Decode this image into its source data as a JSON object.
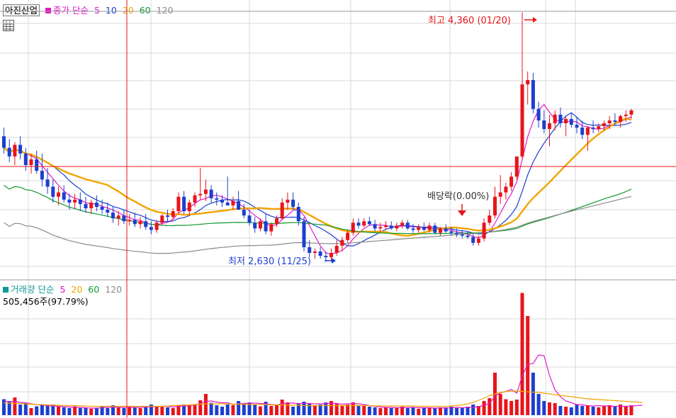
{
  "price_legend": {
    "stock_name": "아진산업",
    "label": "종가 단순",
    "periods": [
      "5",
      "10",
      "20",
      "60",
      "120"
    ]
  },
  "volume_legend": {
    "label": "거래량 단순",
    "periods": [
      "5",
      "20",
      "60",
      "120"
    ],
    "current_volume": "505,456주(97.79%)"
  },
  "annotations": {
    "high": "최고 4,360 (01/20)",
    "low": "최저 2,630 (11/25)",
    "dividend": "배당락(0.00%)"
  },
  "colors": {
    "up": "#e8141b",
    "down": "#1c3fd0",
    "ma5": "#e01bc6",
    "ma10": "#1c3fd0",
    "ma20": "#f2a400",
    "ma60": "#0f9a2e",
    "ma120": "#8a8a8a",
    "crosshair": "#e8141b",
    "grid": "#d8d8d8"
  },
  "chart_data": {
    "type": "candlestick",
    "ma_periods": [
      5,
      10,
      20,
      60,
      120
    ],
    "high": {
      "value": 4360,
      "date": "01/20"
    },
    "low": {
      "value": 2630,
      "date": "11/25"
    },
    "candles": [
      [
        3500,
        3560,
        3380,
        3420,
        45
      ],
      [
        3420,
        3480,
        3320,
        3360,
        40
      ],
      [
        3360,
        3460,
        3300,
        3440,
        50
      ],
      [
        3440,
        3500,
        3340,
        3380,
        30
      ],
      [
        3380,
        3420,
        3260,
        3300,
        35
      ],
      [
        3300,
        3380,
        3240,
        3340,
        20
      ],
      [
        3340,
        3400,
        3240,
        3260,
        25
      ],
      [
        3260,
        3380,
        3150,
        3200,
        30
      ],
      [
        3200,
        3280,
        3100,
        3150,
        28
      ],
      [
        3150,
        3200,
        3040,
        3080,
        30
      ],
      [
        3080,
        3150,
        3020,
        3110,
        25
      ],
      [
        3110,
        3160,
        3040,
        3060,
        22
      ],
      [
        3060,
        3100,
        2990,
        3040,
        20
      ],
      [
        3040,
        3100,
        3000,
        3060,
        25
      ],
      [
        3060,
        3110,
        2980,
        3030,
        20
      ],
      [
        3030,
        3080,
        2970,
        3000,
        22
      ],
      [
        3000,
        3060,
        2960,
        3040,
        18
      ],
      [
        3040,
        3090,
        2980,
        3010,
        20
      ],
      [
        3010,
        3060,
        2960,
        2990,
        25
      ],
      [
        2990,
        3040,
        2940,
        2970,
        20
      ],
      [
        2970,
        3010,
        2900,
        2930,
        28
      ],
      [
        2930,
        2980,
        2880,
        2950,
        22
      ],
      [
        2950,
        2990,
        2890,
        2910,
        20
      ],
      [
        2910,
        2960,
        2880,
        2920,
        25
      ],
      [
        2920,
        2970,
        2870,
        2890,
        22
      ],
      [
        2890,
        2940,
        2860,
        2910,
        20
      ],
      [
        2910,
        2960,
        2850,
        2870,
        25
      ],
      [
        2870,
        2910,
        2820,
        2850,
        30
      ],
      [
        2850,
        2920,
        2830,
        2900,
        24
      ],
      [
        2900,
        2960,
        2880,
        2950,
        26
      ],
      [
        2950,
        2990,
        2910,
        2940,
        22
      ],
      [
        2940,
        3000,
        2920,
        2980,
        20
      ],
      [
        2980,
        3110,
        2960,
        3080,
        28
      ],
      [
        3080,
        3120,
        2960,
        2980,
        30
      ],
      [
        2980,
        3060,
        2950,
        3040,
        26
      ],
      [
        3040,
        3110,
        3010,
        3090,
        30
      ],
      [
        3090,
        3280,
        3060,
        3100,
        42
      ],
      [
        3100,
        3200,
        3050,
        3130,
        60
      ],
      [
        3130,
        3160,
        3040,
        3070,
        35
      ],
      [
        3070,
        3110,
        3020,
        3060,
        28
      ],
      [
        3060,
        3090,
        3010,
        3040,
        24
      ],
      [
        3040,
        3220,
        3020,
        3020,
        30
      ],
      [
        3020,
        3080,
        2990,
        3050,
        28
      ],
      [
        3050,
        3120,
        3020,
        2990,
        40
      ],
      [
        2990,
        3030,
        2930,
        2950,
        34
      ],
      [
        2950,
        2990,
        2880,
        2900,
        36
      ],
      [
        2900,
        2940,
        2830,
        2860,
        30
      ],
      [
        2860,
        2930,
        2840,
        2910,
        25
      ],
      [
        2910,
        2960,
        2820,
        2840,
        38
      ],
      [
        2840,
        2900,
        2810,
        2890,
        26
      ],
      [
        2890,
        2950,
        2870,
        2930,
        30
      ],
      [
        2930,
        3070,
        2920,
        3040,
        44
      ],
      [
        3040,
        3110,
        2990,
        3060,
        36
      ],
      [
        3060,
        3110,
        2990,
        3010,
        24
      ],
      [
        3010,
        3040,
        2880,
        2910,
        32
      ],
      [
        2910,
        2940,
        2700,
        2730,
        38
      ],
      [
        2730,
        2780,
        2660,
        2690,
        34
      ],
      [
        2690,
        2720,
        2650,
        2700,
        28
      ],
      [
        2700,
        2730,
        2650,
        2670,
        30
      ],
      [
        2670,
        2700,
        2630,
        2660,
        36
      ],
      [
        2660,
        2720,
        2630,
        2690,
        40
      ],
      [
        2690,
        2780,
        2670,
        2740,
        32
      ],
      [
        2740,
        2800,
        2700,
        2780,
        28
      ],
      [
        2780,
        2850,
        2760,
        2830,
        30
      ],
      [
        2830,
        2930,
        2810,
        2900,
        36
      ],
      [
        2900,
        2930,
        2860,
        2880,
        28
      ],
      [
        2880,
        2930,
        2870,
        2910,
        26
      ],
      [
        2910,
        2940,
        2880,
        2890,
        24
      ],
      [
        2890,
        2920,
        2840,
        2860,
        22
      ],
      [
        2860,
        2900,
        2830,
        2870,
        20
      ],
      [
        2870,
        2910,
        2850,
        2880,
        22
      ],
      [
        2880,
        2910,
        2850,
        2860,
        20
      ],
      [
        2860,
        2900,
        2840,
        2880,
        22
      ],
      [
        2880,
        2920,
        2860,
        2900,
        24
      ],
      [
        2900,
        2920,
        2850,
        2860,
        20
      ],
      [
        2860,
        2890,
        2830,
        2850,
        22
      ],
      [
        2850,
        2890,
        2830,
        2870,
        18
      ],
      [
        2870,
        2900,
        2840,
        2850,
        20
      ],
      [
        2850,
        2900,
        2830,
        2880,
        22
      ],
      [
        2880,
        2900,
        2820,
        2830,
        20
      ],
      [
        2830,
        2870,
        2810,
        2860,
        20
      ],
      [
        2860,
        2890,
        2830,
        2840,
        22
      ],
      [
        2840,
        2870,
        2810,
        2830,
        24
      ],
      [
        2830,
        2860,
        2800,
        2820,
        20
      ],
      [
        2820,
        2850,
        2790,
        2810,
        22
      ],
      [
        2810,
        2840,
        2790,
        2800,
        24
      ],
      [
        2800,
        2820,
        2740,
        2760,
        30
      ],
      [
        2760,
        2810,
        2740,
        2790,
        26
      ],
      [
        2790,
        2930,
        2770,
        2900,
        40
      ],
      [
        2900,
        2990,
        2880,
        2950,
        48
      ],
      [
        2950,
        3150,
        2930,
        3080,
        120
      ],
      [
        3080,
        3230,
        3030,
        3110,
        60
      ],
      [
        3110,
        3180,
        3060,
        3150,
        45
      ],
      [
        3150,
        3250,
        3120,
        3220,
        40
      ],
      [
        3220,
        3360,
        3200,
        3360,
        44
      ],
      [
        3360,
        4360,
        3340,
        3860,
        345
      ],
      [
        3860,
        3950,
        3720,
        3890,
        280
      ],
      [
        3890,
        3940,
        3660,
        3690,
        120
      ],
      [
        3690,
        3740,
        3560,
        3610,
        60
      ],
      [
        3610,
        3680,
        3520,
        3550,
        40
      ],
      [
        3550,
        3650,
        3430,
        3590,
        36
      ],
      [
        3590,
        3680,
        3540,
        3650,
        34
      ],
      [
        3650,
        3700,
        3560,
        3590,
        26
      ],
      [
        3590,
        3640,
        3500,
        3620,
        24
      ],
      [
        3620,
        3660,
        3560,
        3580,
        22
      ],
      [
        3580,
        3630,
        3520,
        3560,
        30
      ],
      [
        3560,
        3610,
        3480,
        3510,
        26
      ],
      [
        3510,
        3570,
        3400,
        3560,
        28
      ],
      [
        3560,
        3610,
        3520,
        3550,
        24
      ],
      [
        3550,
        3590,
        3530,
        3570,
        22
      ],
      [
        3570,
        3610,
        3540,
        3590,
        26
      ],
      [
        3590,
        3640,
        3550,
        3610,
        28
      ],
      [
        3610,
        3660,
        3580,
        3600,
        26
      ],
      [
        3600,
        3650,
        3560,
        3640,
        30
      ],
      [
        3640,
        3680,
        3600,
        3650,
        26
      ],
      [
        3650,
        3690,
        3620,
        3680,
        28
      ]
    ],
    "volume_ma5": [
      40,
      38,
      39,
      36,
      35,
      32,
      30,
      29,
      27,
      26,
      25,
      24,
      23,
      22,
      22,
      21,
      20,
      20,
      21,
      22,
      23,
      22,
      22,
      23,
      22,
      22,
      23,
      24,
      24,
      25,
      25,
      23,
      25,
      26,
      27,
      29,
      33,
      39,
      40,
      37,
      35,
      35,
      30,
      32,
      33,
      34,
      34,
      33,
      32,
      30,
      29,
      32,
      34,
      34,
      33,
      33,
      33,
      32,
      32,
      33,
      34,
      33,
      31,
      32,
      33,
      32,
      30,
      27,
      25,
      23,
      22,
      22,
      21,
      21,
      22,
      22,
      21,
      21,
      21,
      20,
      21,
      20,
      21,
      22,
      21,
      22,
      22,
      24,
      28,
      33,
      53,
      63,
      67,
      73,
      62,
      111,
      143,
      146,
      170,
      168,
      112,
      71,
      52,
      40,
      35,
      30,
      29,
      27,
      26,
      27,
      26,
      26,
      25,
      25,
      25,
      26,
      27,
      28
    ],
    "volume_ma20": [
      34,
      34,
      33,
      33,
      32,
      31,
      30,
      30,
      29,
      28,
      28,
      27,
      27,
      27,
      26,
      26,
      25,
      25,
      25,
      25,
      25,
      25,
      25,
      25,
      25,
      25,
      25,
      25,
      25,
      25,
      26,
      27,
      28,
      28,
      29,
      30,
      31,
      32,
      32,
      32,
      32,
      32,
      31,
      31,
      31,
      30,
      30,
      30,
      30,
      29,
      29,
      29,
      28,
      28,
      28,
      27,
      27,
      27,
      27,
      27,
      27,
      27,
      27,
      27,
      27,
      27,
      27,
      27,
      26,
      26,
      26,
      26,
      26,
      26,
      26,
      26,
      25,
      25,
      25,
      25,
      25,
      25,
      26,
      27,
      29,
      32,
      36,
      42,
      48,
      55,
      60,
      64,
      67,
      68,
      68,
      67,
      66,
      65,
      64,
      62,
      60,
      58,
      56,
      54,
      52,
      50,
      48,
      46,
      45,
      44,
      43,
      42,
      41,
      40,
      39,
      38,
      37,
      36
    ]
  }
}
